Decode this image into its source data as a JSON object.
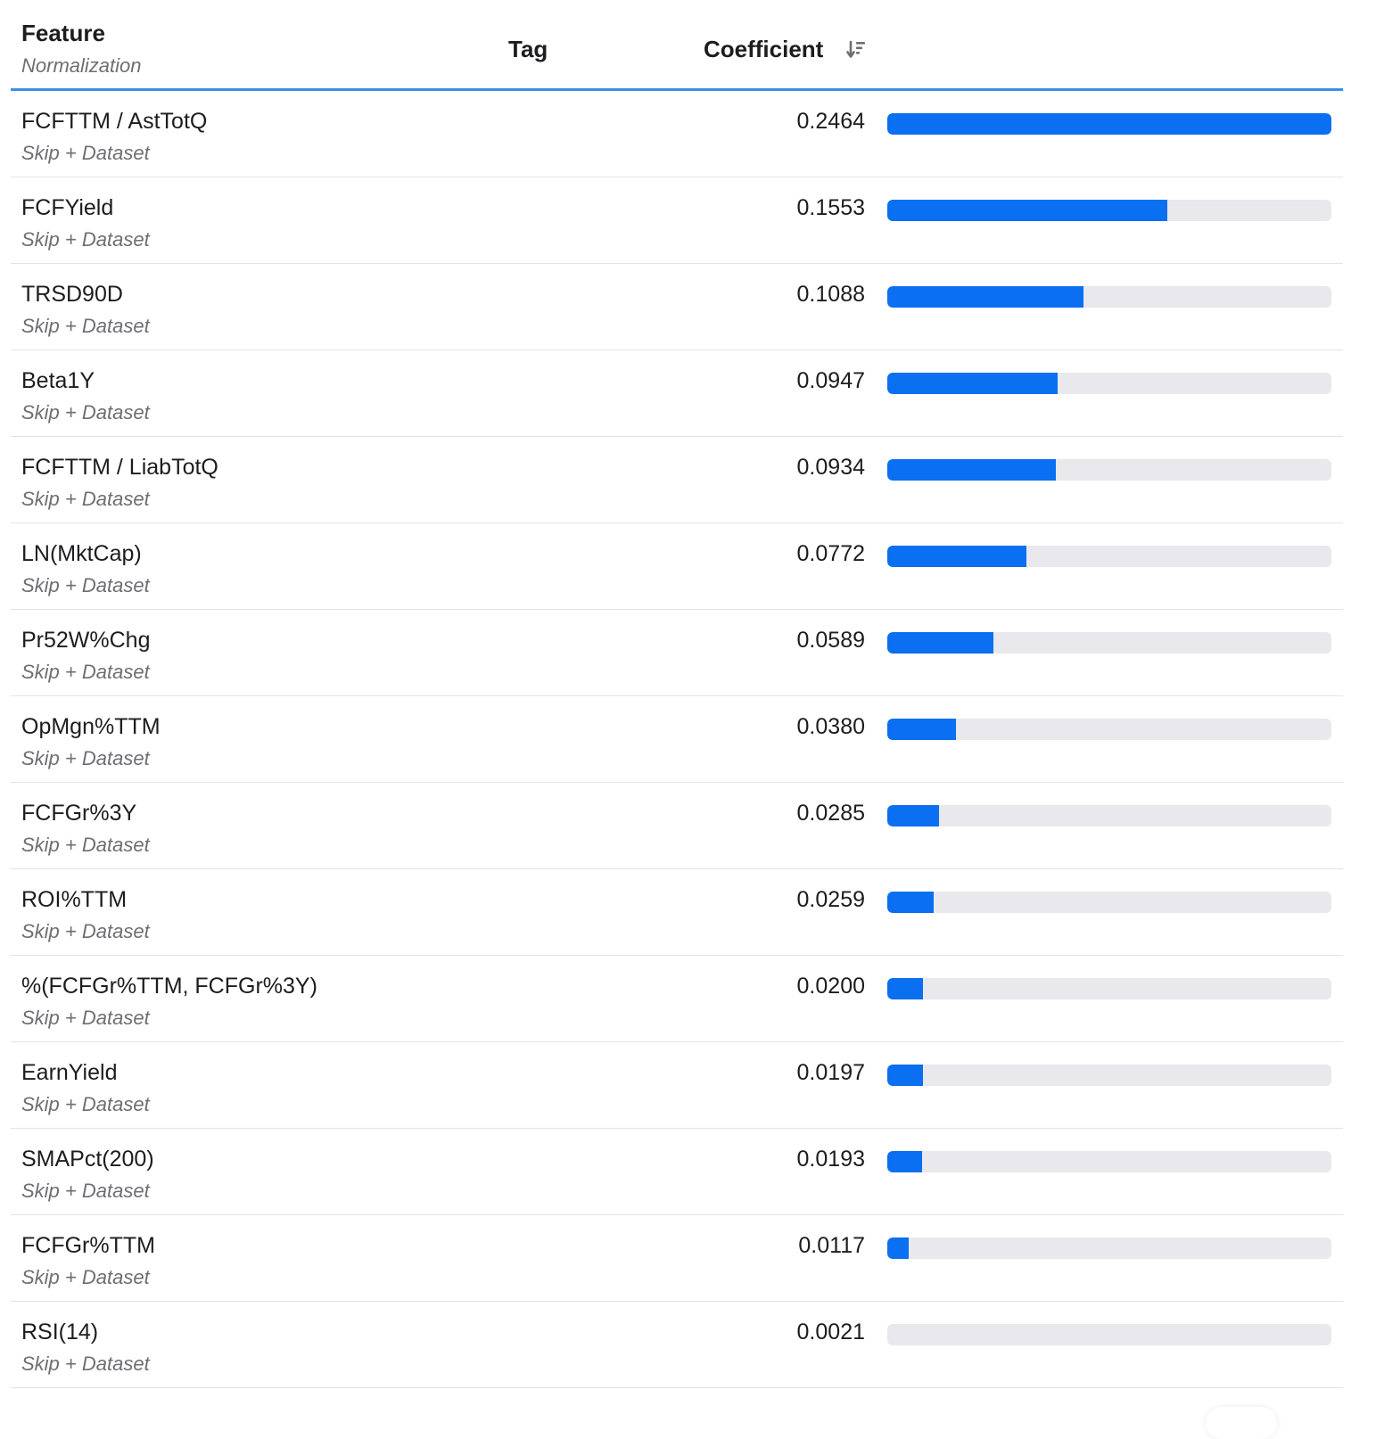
{
  "header": {
    "feature_label": "Feature",
    "normalization_label": "Normalization",
    "tag_label": "Tag",
    "coefficient_label": "Coefficient",
    "sort_icon": "sort-descending-icon"
  },
  "colors": {
    "bar_fill": "#0a6ff0",
    "bar_track": "#e8e8ed",
    "header_underline": "#3d8fe8"
  },
  "scale_max": 0.2464,
  "rows": [
    {
      "feature": "FCFTTM / AstTotQ",
      "normalization": "Skip + Dataset",
      "tag": "",
      "coefficient": "0.2464",
      "value": 0.2464
    },
    {
      "feature": "FCFYield",
      "normalization": "Skip + Dataset",
      "tag": "",
      "coefficient": "0.1553",
      "value": 0.1553
    },
    {
      "feature": "TRSD90D",
      "normalization": "Skip + Dataset",
      "tag": "",
      "coefficient": "0.1088",
      "value": 0.1088
    },
    {
      "feature": "Beta1Y",
      "normalization": "Skip + Dataset",
      "tag": "",
      "coefficient": "0.0947",
      "value": 0.0947
    },
    {
      "feature": "FCFTTM / LiabTotQ",
      "normalization": "Skip + Dataset",
      "tag": "",
      "coefficient": "0.0934",
      "value": 0.0934
    },
    {
      "feature": "LN(MktCap)",
      "normalization": "Skip + Dataset",
      "tag": "",
      "coefficient": "0.0772",
      "value": 0.0772
    },
    {
      "feature": "Pr52W%Chg",
      "normalization": "Skip + Dataset",
      "tag": "",
      "coefficient": "0.0589",
      "value": 0.0589
    },
    {
      "feature": "OpMgn%TTM",
      "normalization": "Skip + Dataset",
      "tag": "",
      "coefficient": "0.0380",
      "value": 0.038
    },
    {
      "feature": "FCFGr%3Y",
      "normalization": "Skip + Dataset",
      "tag": "",
      "coefficient": "0.0285",
      "value": 0.0285
    },
    {
      "feature": "ROI%TTM",
      "normalization": "Skip + Dataset",
      "tag": "",
      "coefficient": "0.0259",
      "value": 0.0259
    },
    {
      "feature": "%(FCFGr%TTM, FCFGr%3Y)",
      "normalization": "Skip + Dataset",
      "tag": "",
      "coefficient": "0.0200",
      "value": 0.02
    },
    {
      "feature": "EarnYield",
      "normalization": "Skip + Dataset",
      "tag": "",
      "coefficient": "0.0197",
      "value": 0.0197
    },
    {
      "feature": "SMAPct(200)",
      "normalization": "Skip + Dataset",
      "tag": "",
      "coefficient": "0.0193",
      "value": 0.0193
    },
    {
      "feature": "FCFGr%TTM",
      "normalization": "Skip + Dataset",
      "tag": "",
      "coefficient": "0.0117",
      "value": 0.0117
    },
    {
      "feature": "RSI(14)",
      "normalization": "Skip + Dataset",
      "tag": "",
      "coefficient": "0.0021",
      "value": 0.0021
    }
  ]
}
